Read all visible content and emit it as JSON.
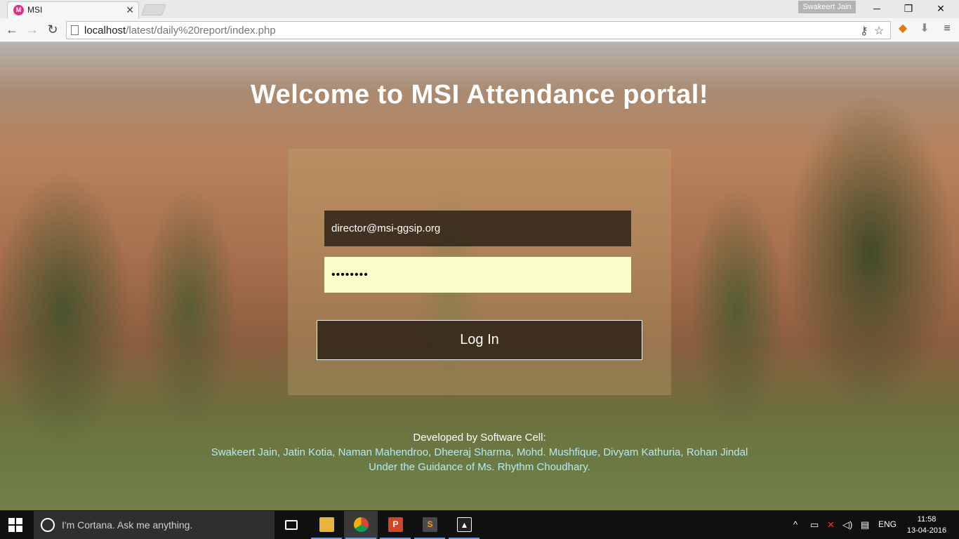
{
  "browser": {
    "tab_title": "MSI",
    "tab_favicon": "M",
    "user_name": "Swakeert Jain",
    "url_host": "localhost",
    "url_path": "/latest/daily%20report/index.php"
  },
  "page": {
    "title": "Welcome to MSI Attendance portal!",
    "email_value": "director@msi-ggsip.org",
    "password_value": "••••••••",
    "login_label": "Log In",
    "credits_line1": "Developed by Software Cell:",
    "credits_names": "Swakeert Jain, Jatin Kotia, Naman Mahendroo, Dheeraj Sharma, Mohd. Mushfique, Divyam Kathuria, Rohan Jindal",
    "credits_guidance": "Under the Guidance of Ms. Rhythm Choudhary."
  },
  "taskbar": {
    "cortana_placeholder": "I'm Cortana. Ask me anything.",
    "language": "ENG",
    "time": "11:58",
    "date": "13-04-2016",
    "apps": [
      "task-view",
      "file-explorer",
      "chrome",
      "powerpoint",
      "sublime-text",
      "photos"
    ]
  },
  "colors": {
    "accent_credit": "#b7eaf0",
    "password_bg": "#fbfdc8",
    "favicon": "#e03189"
  }
}
